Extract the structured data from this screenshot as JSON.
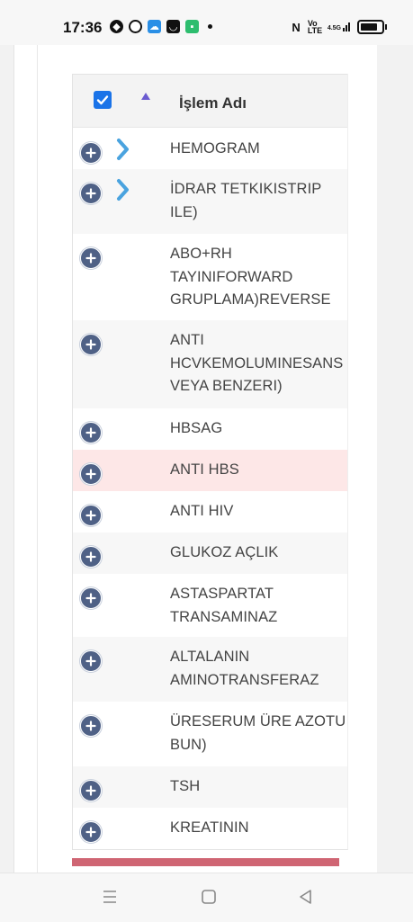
{
  "status": {
    "time": "17:36",
    "network_label": "4.5G",
    "volte_label": "Vo LTE"
  },
  "header": {
    "column_title": "İşlem Adı",
    "select_all_checked": true
  },
  "rows": [
    {
      "name": "HEMOGRAM"
    },
    {
      "name": "İDRAR TETKIKISTRIP ILE)"
    },
    {
      "name": "ABO+RH TAYINIFORWARD GRUPLAMA)REVERSE"
    },
    {
      "name": "ANTI HCVKEMOLUMINESANS VEYA BENZERI)"
    },
    {
      "name": "HBSAG"
    },
    {
      "name": "ANTI HBS"
    },
    {
      "name": "ANTI HIV"
    },
    {
      "name": "GLUKOZ AÇLIK"
    },
    {
      "name": "ASTASPARTAT TRANSAMINAZ"
    },
    {
      "name": "ALTALANIN AMINOTRANSFERAZ"
    },
    {
      "name": "ÜRESERUM ÜRE AZOTU BUN)"
    },
    {
      "name": "TSH"
    },
    {
      "name": "KREATININ"
    }
  ],
  "colors": {
    "checkbox": "#1a73e8",
    "expand_button": "#4f6186",
    "chevron": "#4aa3df",
    "highlight_row": "#fde7e7",
    "footer_bar": "#cf6573"
  }
}
